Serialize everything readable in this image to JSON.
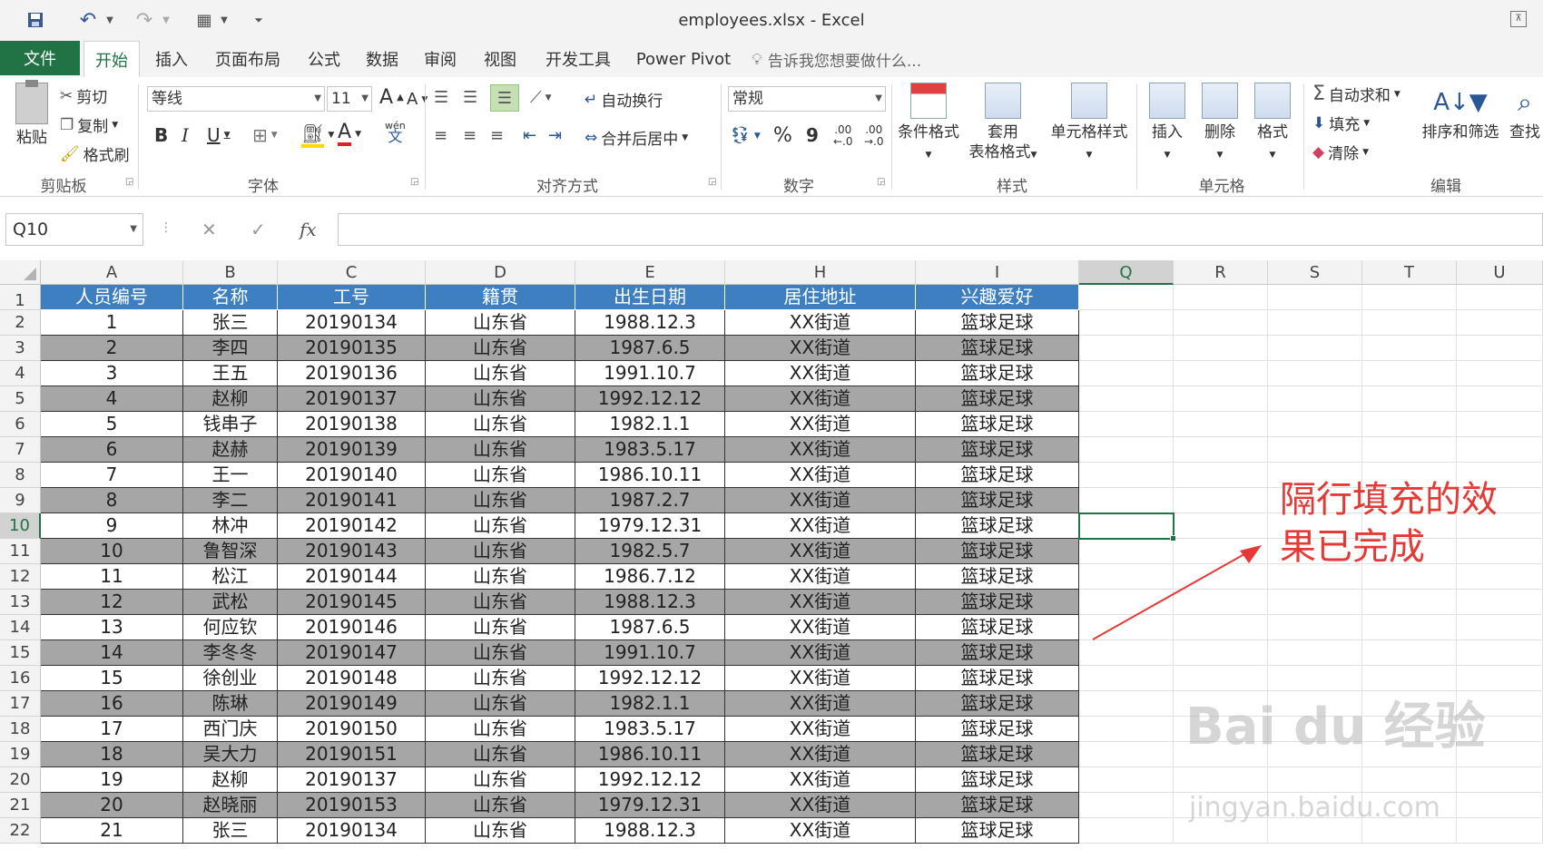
{
  "window": {
    "title": "employees.xlsx - Excel"
  },
  "quick_access": {
    "save_icon": "save-icon",
    "undo_icon": "undo-icon",
    "redo_icon": "redo-icon",
    "form_icon": "form-icon",
    "customize_icon": "customize-qat-icon"
  },
  "tabs": {
    "file": "文件",
    "items": [
      "开始",
      "插入",
      "页面布局",
      "公式",
      "数据",
      "审阅",
      "视图",
      "开发工具",
      "Power Pivot"
    ],
    "active": "开始",
    "tell_me": "告诉我您想要做什么..."
  },
  "ribbon": {
    "clipboard": {
      "paste": "粘贴",
      "cut": "剪切",
      "copy": "复制",
      "format_painter": "格式刷",
      "label": "剪贴板"
    },
    "font": {
      "name": "等线",
      "size": "11",
      "bold": "B",
      "italic": "I",
      "underline": "U",
      "grow": "A",
      "shrink": "A",
      "color_a": "A",
      "wen": "wén",
      "wen_char": "文",
      "label": "字体"
    },
    "alignment": {
      "wrap": "自动换行",
      "merge": "合并后居中",
      "label": "对齐方式"
    },
    "number": {
      "format": "常规",
      "percent": "%",
      "comma": "9",
      "inc_dec": ".00",
      "dec_dec": ".00",
      "label": "数字"
    },
    "styles": {
      "conditional": "条件格式",
      "table_format_1": "套用",
      "table_format_2": "表格格式",
      "cell_styles": "单元格样式",
      "label": "样式"
    },
    "cells": {
      "insert": "插入",
      "delete": "删除",
      "format": "格式",
      "label": "单元格"
    },
    "editing": {
      "autosum": "自动求和",
      "fill": "填充",
      "clear": "清除",
      "sort_filter": "排序和筛选",
      "find": "查找",
      "label": "编辑"
    }
  },
  "formula_bar": {
    "name_box": "Q10",
    "cancel": "✕",
    "enter": "✓",
    "fx": "fx",
    "value": ""
  },
  "sheet": {
    "columns": [
      "A",
      "B",
      "C",
      "D",
      "E",
      "H",
      "I",
      "Q",
      "R",
      "S",
      "T",
      "U"
    ],
    "selected_column": "Q",
    "selected_row": "10",
    "row_numbers": [
      "1",
      "2",
      "3",
      "4",
      "5",
      "6",
      "7",
      "8",
      "9",
      "10",
      "11",
      "12",
      "13",
      "14",
      "15",
      "16",
      "17",
      "18",
      "19",
      "20",
      "21",
      "22"
    ],
    "headers": [
      "人员编号",
      "名称",
      "工号",
      "籍贯",
      "出生日期",
      "居住地址",
      "兴趣爱好"
    ],
    "rows": [
      [
        "1",
        "张三",
        "20190134",
        "山东省",
        "1988.12.3",
        "XX街道",
        "篮球足球"
      ],
      [
        "2",
        "李四",
        "20190135",
        "山东省",
        "1987.6.5",
        "XX街道",
        "篮球足球"
      ],
      [
        "3",
        "王五",
        "20190136",
        "山东省",
        "1991.10.7",
        "XX街道",
        "篮球足球"
      ],
      [
        "4",
        "赵柳",
        "20190137",
        "山东省",
        "1992.12.12",
        "XX街道",
        "篮球足球"
      ],
      [
        "5",
        "钱串子",
        "20190138",
        "山东省",
        "1982.1.1",
        "XX街道",
        "篮球足球"
      ],
      [
        "6",
        "赵赫",
        "20190139",
        "山东省",
        "1983.5.17",
        "XX街道",
        "篮球足球"
      ],
      [
        "7",
        "王一",
        "20190140",
        "山东省",
        "1986.10.11",
        "XX街道",
        "篮球足球"
      ],
      [
        "8",
        "李二",
        "20190141",
        "山东省",
        "1987.2.7",
        "XX街道",
        "篮球足球"
      ],
      [
        "9",
        "林冲",
        "20190142",
        "山东省",
        "1979.12.31",
        "XX街道",
        "篮球足球"
      ],
      [
        "10",
        "鲁智深",
        "20190143",
        "山东省",
        "1982.5.7",
        "XX街道",
        "篮球足球"
      ],
      [
        "11",
        "松江",
        "20190144",
        "山东省",
        "1986.7.12",
        "XX街道",
        "篮球足球"
      ],
      [
        "12",
        "武松",
        "20190145",
        "山东省",
        "1988.12.3",
        "XX街道",
        "篮球足球"
      ],
      [
        "13",
        "何应钦",
        "20190146",
        "山东省",
        "1987.6.5",
        "XX街道",
        "篮球足球"
      ],
      [
        "14",
        "李冬冬",
        "20190147",
        "山东省",
        "1991.10.7",
        "XX街道",
        "篮球足球"
      ],
      [
        "15",
        "徐创业",
        "20190148",
        "山东省",
        "1992.12.12",
        "XX街道",
        "篮球足球"
      ],
      [
        "16",
        "陈琳",
        "20190149",
        "山东省",
        "1982.1.1",
        "XX街道",
        "篮球足球"
      ],
      [
        "17",
        "西门庆",
        "20190150",
        "山东省",
        "1983.5.17",
        "XX街道",
        "篮球足球"
      ],
      [
        "18",
        "吴大力",
        "20190151",
        "山东省",
        "1986.10.11",
        "XX街道",
        "篮球足球"
      ],
      [
        "19",
        "赵柳",
        "20190137",
        "山东省",
        "1992.12.12",
        "XX街道",
        "篮球足球"
      ],
      [
        "20",
        "赵晓丽",
        "20190153",
        "山东省",
        "1979.12.31",
        "XX街道",
        "篮球足球"
      ],
      [
        "21",
        "张三",
        "20190134",
        "山东省",
        "1988.12.3",
        "XX街道",
        "篮球足球"
      ]
    ],
    "header_color": "#3d7fc1",
    "stripe_color": "#a6a6a6"
  },
  "annotation": {
    "line1": "隔行填充的效",
    "line2": "果已完成",
    "color": "#e53935"
  },
  "watermark": {
    "main": "Bai du 经验",
    "sub": "jingyan.baidu.com"
  }
}
